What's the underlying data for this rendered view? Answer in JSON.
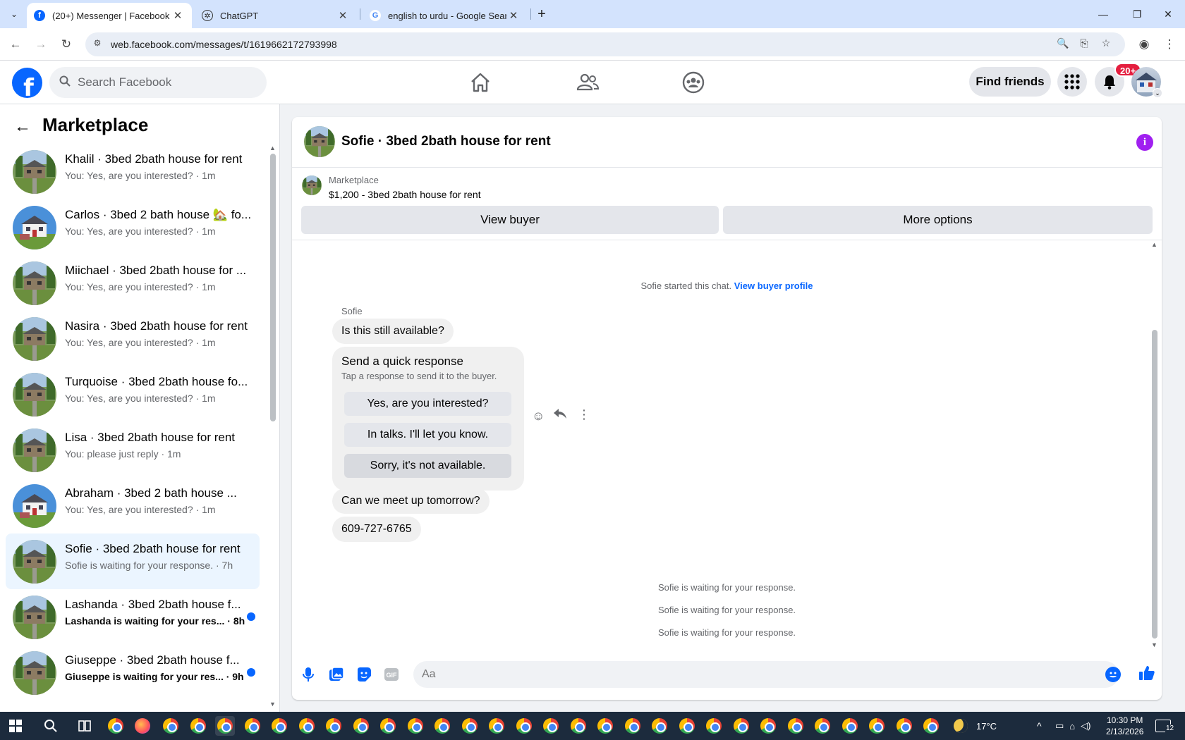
{
  "browser": {
    "tabs": [
      {
        "title": "(20+) Messenger | Facebook",
        "active": true
      },
      {
        "title": "ChatGPT",
        "active": false
      },
      {
        "title": "english to urdu - Google Search",
        "active": false
      }
    ],
    "url": "web.facebook.com/messages/t/1619662172793998"
  },
  "fb": {
    "search_placeholder": "Search Facebook",
    "find_friends": "Find friends",
    "notif_badge": "20+",
    "brand_color": "#0866ff"
  },
  "sidebar": {
    "title": "Marketplace",
    "conversations": [
      {
        "name": "Khalil · 3bed 2bath house for rent",
        "preview": "You: Yes, are you interested? · 1m",
        "house": "a",
        "selected": false,
        "unread": false
      },
      {
        "name": "Carlos · 3bed 2 bath house 🏡 fo...",
        "preview": "You: Yes, are you interested? · 1m",
        "house": "b",
        "selected": false,
        "unread": false
      },
      {
        "name": "Miichael · 3bed 2bath house for ...",
        "preview": "You: Yes, are you interested? · 1m",
        "house": "a",
        "selected": false,
        "unread": false
      },
      {
        "name": "Nasira · 3bed 2bath house for rent",
        "preview": "You: Yes, are you interested? · 1m",
        "house": "a",
        "selected": false,
        "unread": false
      },
      {
        "name": "Turquoise · 3bed 2bath house fo...",
        "preview": "You: Yes, are you interested? · 1m",
        "house": "a",
        "selected": false,
        "unread": false
      },
      {
        "name": "Lisa · 3bed 2bath house for rent",
        "preview": "You: please just reply · 1m",
        "house": "a",
        "selected": false,
        "unread": false
      },
      {
        "name": "Abraham · 3bed 2 bath house ...",
        "preview": "You: Yes, are you interested? · 1m",
        "house": "b",
        "selected": false,
        "unread": false
      },
      {
        "name": "Sofie · 3bed 2bath house for rent",
        "preview": "Sofie is waiting for your response. · 7h",
        "house": "a",
        "selected": true,
        "unread": false
      },
      {
        "name": "Lashanda · 3bed 2bath house f...",
        "preview": "Lashanda is waiting for your res... · 8h",
        "house": "a",
        "selected": false,
        "unread": true
      },
      {
        "name": "Giuseppe · 3bed 2bath house f...",
        "preview": "Giuseppe is waiting for your res... · 9h",
        "house": "a",
        "selected": false,
        "unread": true
      }
    ]
  },
  "chat": {
    "title": "Sofie · 3bed 2bath house for rent",
    "marketplace_label": "Marketplace",
    "listing": "$1,200 - 3bed 2bath house for rent",
    "view_buyer": "View buyer",
    "more_options": "More options",
    "started": "Sofie started this chat.",
    "view_buyer_profile": "View buyer profile",
    "sender": "Sofie",
    "messages": [
      "Is this still available?",
      "Can we meet up tomorrow?",
      "609-727-6765"
    ],
    "quick_title": "Send a quick response",
    "quick_sub": "Tap a response to send it to the buyer.",
    "quick_options": [
      "Yes, are you interested?",
      "In talks. I'll let you know.",
      "Sorry, it's not available."
    ],
    "waiting": [
      "Sofie is waiting for your response.",
      "Sofie is waiting for your response.",
      "Sofie is waiting for your response."
    ],
    "input_placeholder": "Aa"
  },
  "taskbar": {
    "temp": "17°C",
    "time": "10:30 PM",
    "date": "2/13/2026",
    "notif_count": "12"
  }
}
